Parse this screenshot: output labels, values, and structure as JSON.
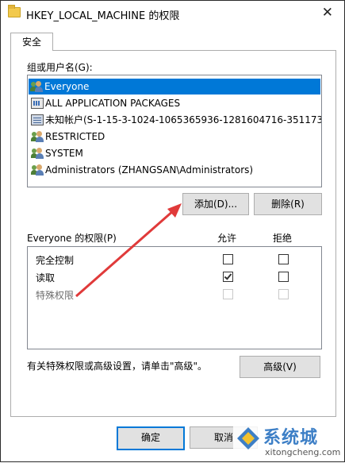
{
  "window": {
    "title": "HKEY_LOCAL_MACHINE 的权限",
    "close_glyph": "✕"
  },
  "tabs": [
    {
      "label": "安全",
      "selected": true
    }
  ],
  "groups": {
    "label": "组或用户名(G):",
    "items": [
      {
        "label": "Everyone",
        "icon": "users-icon",
        "selected": true
      },
      {
        "label": "ALL APPLICATION PACKAGES",
        "icon": "package-icon",
        "selected": false
      },
      {
        "label": "未知帐户(S-1-15-3-1024-1065365936-1281604716-351173...",
        "icon": "unknown-account-icon",
        "selected": false
      },
      {
        "label": "RESTRICTED",
        "icon": "users-icon",
        "selected": false
      },
      {
        "label": "SYSTEM",
        "icon": "users-icon",
        "selected": false
      },
      {
        "label": "Administrators (ZHANGSAN\\Administrators)",
        "icon": "users-icon",
        "selected": false
      }
    ],
    "add_label": "添加(D)...",
    "remove_label": "删除(R)"
  },
  "permissions": {
    "header": "Everyone 的权限(P)",
    "allow_label": "允许",
    "deny_label": "拒绝",
    "rows": [
      {
        "name": "完全控制",
        "allow": false,
        "deny": false,
        "disabled": false
      },
      {
        "name": "读取",
        "allow": true,
        "deny": false,
        "disabled": false
      },
      {
        "name": "特殊权限",
        "allow": false,
        "deny": false,
        "disabled": true
      }
    ]
  },
  "advanced": {
    "hint": "有关特殊权限或高级设置，请单击\"高级\"。",
    "button_label": "高级(V)"
  },
  "footer": {
    "ok_label": "确定",
    "cancel_label": "取消"
  },
  "watermark": {
    "cn": "系统城",
    "en": "xitongcheng.com"
  },
  "colors": {
    "selection": "#0078d7",
    "arrow": "#e03a3a",
    "watermark": "#3d7fc6"
  }
}
